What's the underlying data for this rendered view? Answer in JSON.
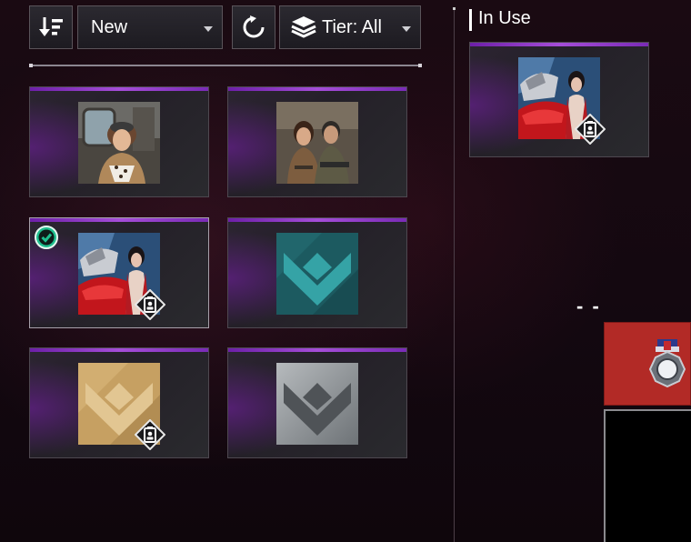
{
  "toolbar": {
    "sort_icon": "sort-descending-icon",
    "order_dropdown_value": "New",
    "refresh_icon": "refresh-icon",
    "tier_icon": "layers-icon",
    "tier_dropdown_value": "Tier: All"
  },
  "grid": {
    "items": [
      {
        "thumbnail": "character-portrait-woman-goggles",
        "selected": false,
        "locked": false
      },
      {
        "thumbnail": "character-portrait-duo-soldiers",
        "selected": false,
        "locked": false
      },
      {
        "thumbnail": "character-portrait-mech-rider",
        "selected": true,
        "locked": true
      },
      {
        "thumbnail": "rank-emblem-teal",
        "selected": false,
        "locked": false
      },
      {
        "thumbnail": "rank-emblem-gold",
        "selected": false,
        "locked": true
      },
      {
        "thumbnail": "rank-emblem-silver",
        "selected": false,
        "locked": false
      }
    ]
  },
  "in_use": {
    "title": "In Use",
    "item": {
      "thumbnail": "character-portrait-mech-rider",
      "locked": true
    }
  },
  "slot_placeholder": "- -",
  "equip_slot": {
    "icon": "medal-badge-icon"
  },
  "colors": {
    "tier_accent": "#8a35c4",
    "check_green": "#1fbf8f",
    "equip_red": "#b22a26"
  }
}
